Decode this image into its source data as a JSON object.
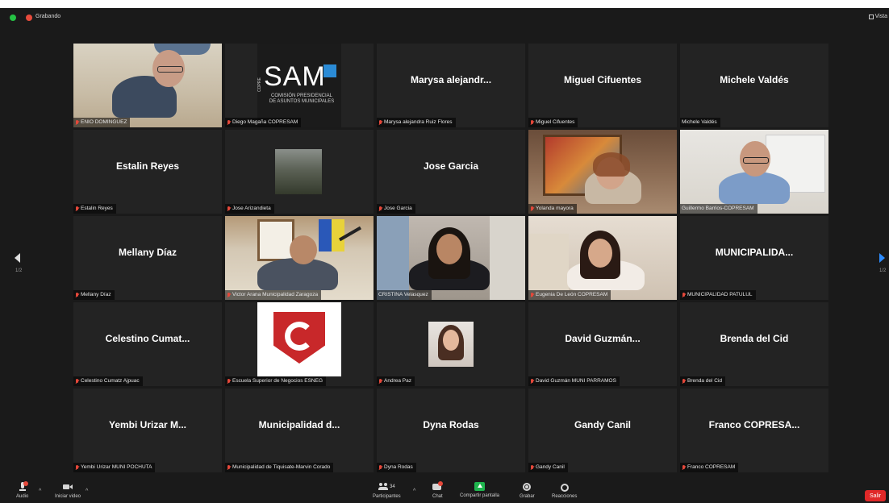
{
  "recording": {
    "label": "Grabando"
  },
  "view": {
    "label": "Vista"
  },
  "pager": {
    "left": "1/2",
    "right": "1/2"
  },
  "tiles": [
    {
      "id": "enio",
      "label": "ENIO DOMINGUEZ"
    },
    {
      "id": "diego",
      "label": "Diego Magaña COPRESAM",
      "logo_main": "SAM",
      "logo_side": "COPRE",
      "logo_sub1": "COMISIÓN PRESIDENCIAL",
      "logo_sub2": "DE ASUNTOS MUNICIPALES"
    },
    {
      "id": "marysa",
      "name": "Marysa alejandr...",
      "label": "Marysa alejandra Ruiz Flores"
    },
    {
      "id": "miguel",
      "name": "Miguel Cifuentes",
      "label": "Miguel Cifuentes"
    },
    {
      "id": "michele",
      "name": "Michele Valdés",
      "label": "Michele Valdés"
    },
    {
      "id": "estalin",
      "name": "Estalin Reyes",
      "label": "Estalin Reyes"
    },
    {
      "id": "jose-a",
      "label": "Jose Arizandieta"
    },
    {
      "id": "jose-g",
      "name": "Jose Garcia",
      "label": "Jose Garcia"
    },
    {
      "id": "yolanda",
      "label": "Yolanda mayora"
    },
    {
      "id": "guillermo",
      "label": "Guillermo Barrios-COPRESAM"
    },
    {
      "id": "mellany",
      "name": "Mellany Díaz",
      "label": "Mellany Díaz"
    },
    {
      "id": "victor",
      "label": "Victor Arana Municipalidad Zaragoza"
    },
    {
      "id": "cristina",
      "label": "CRISTINA Velasquez"
    },
    {
      "id": "eugenia",
      "label": "Eugenia De León COPRESAM"
    },
    {
      "id": "patulul",
      "name": "MUNICIPALIDA...",
      "label": "MUNICIPALIDAD PATULUL"
    },
    {
      "id": "celestino",
      "name": "Celestino Cumat...",
      "label": "Celestino Cumatz Ajpuac"
    },
    {
      "id": "escuela",
      "label": "Escuela Superior de Negocios ESNEG"
    },
    {
      "id": "andrea",
      "label": "Andrea Paz"
    },
    {
      "id": "david",
      "name": "David Guzmán...",
      "label": "David Guzmán MUNI PARRAMOS"
    },
    {
      "id": "brenda",
      "name": "Brenda del Cid",
      "label": "Brenda del Cid"
    },
    {
      "id": "yembi",
      "name": "Yembi Urizar M...",
      "label": "Yembi Urizar MUNI POCHUTA"
    },
    {
      "id": "tiquisate",
      "name": "Municipalidad d...",
      "label": "Municipalidad de Tiquisate-Marvin Corado"
    },
    {
      "id": "dyna",
      "name": "Dyna Rodas",
      "label": "Dyna Rodas"
    },
    {
      "id": "gandy",
      "name": "Gandy Canil",
      "label": "Gandy Canil"
    },
    {
      "id": "franco",
      "name": "Franco COPRESA...",
      "label": "Franco COPRESAM"
    }
  ],
  "toolbar": {
    "audio": "Audio",
    "video": "Iniciar video",
    "participants": "Participantes",
    "participants_count": "34",
    "chat": "Chat",
    "share": "Compartir pantalla",
    "record": "Grabar",
    "reactions": "Reacciones",
    "leave": "Salir"
  },
  "colors": {
    "active_speaker": "#c7de3a",
    "share": "#1fb54e",
    "leave": "#e02828",
    "mute": "#e5483a"
  }
}
